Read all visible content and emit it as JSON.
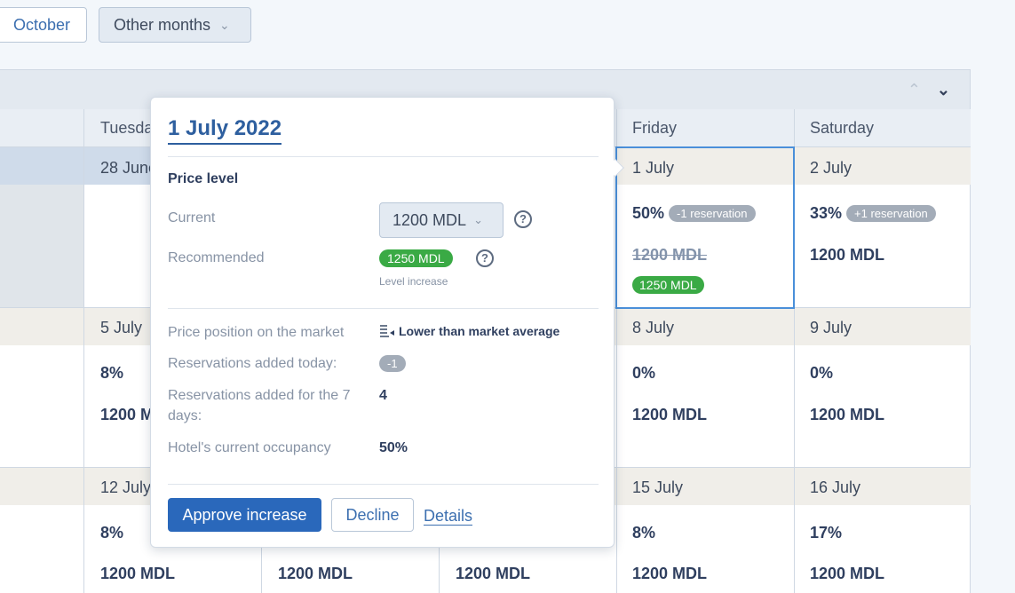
{
  "months": {
    "october": "October",
    "other": "Other months"
  },
  "calendar": {
    "headers": {
      "tuesday": "Tuesday",
      "friday": "Friday",
      "saturday": "Saturday"
    },
    "week1": {
      "tue": {
        "date": "28 June"
      },
      "fri": {
        "date": "1 July",
        "pct": "50%",
        "badge": "-1 reservation",
        "old_price": "1200 MDL",
        "new_price": "1250 MDL"
      },
      "sat": {
        "date": "2 July",
        "pct": "33%",
        "badge": "+1 reservation",
        "price": "1200 MDL"
      }
    },
    "week2": {
      "tue": {
        "date": "5 July",
        "pct": "8%",
        "price": "1200 MDL"
      },
      "fri": {
        "date": "8 July",
        "pct": "0%",
        "price": "1200 MDL"
      },
      "sat": {
        "date": "9 July",
        "pct": "0%",
        "price": "1200 MDL"
      }
    },
    "week3": {
      "tue": {
        "date": "12 July",
        "pct": "8%",
        "price": "1200 MDL"
      },
      "wed": {
        "price": "1200 MDL"
      },
      "thu": {
        "price": "1200 MDL"
      },
      "fri": {
        "date": "15 July",
        "pct": "8%",
        "price": "1200 MDL"
      },
      "sat": {
        "date": "16 July",
        "pct": "17%",
        "price": "1200 MDL"
      }
    }
  },
  "popover": {
    "title": "1 July 2022",
    "section": "Price level",
    "current_label": "Current",
    "current_value": "1200 MDL",
    "recommended_label": "Recommended",
    "recommended_value": "1250 MDL",
    "recommended_note": "Level increase",
    "market_label": "Price position on the market",
    "market_value": "Lower than market average",
    "today_label": "Reservations added today:",
    "today_value": "-1",
    "week_label": "Reservations added for the 7 days:",
    "week_value": "4",
    "occupancy_label": "Hotel's current occupancy",
    "occupancy_value": "50%",
    "approve": "Approve increase",
    "decline": "Decline",
    "details": "Details"
  }
}
